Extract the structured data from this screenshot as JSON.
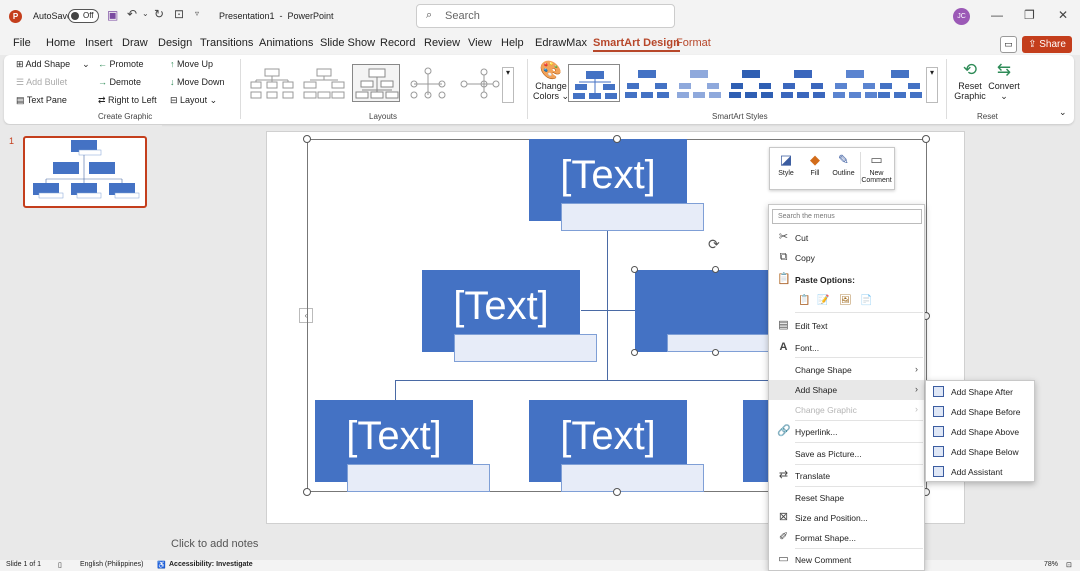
{
  "titlebar": {
    "autosave_label": "AutoSave",
    "autosave_state": "Off",
    "doc_title": "Presentation1  -  PowerPoint",
    "search_placeholder": "Search",
    "avatar_initials": "JC"
  },
  "tabs": [
    "File",
    "Home",
    "Insert",
    "Draw",
    "Design",
    "Transitions",
    "Animations",
    "Slide Show",
    "Record",
    "Review",
    "View",
    "Help",
    "EdrawMax",
    "SmartArt Design",
    "Format"
  ],
  "active_tab": "SmartArt Design",
  "share_label": "Share",
  "ribbon": {
    "create_graphic": {
      "add_shape": "Add Shape",
      "add_bullet": "Add Bullet",
      "text_pane": "Text Pane",
      "promote": "Promote",
      "demote": "Demote",
      "right_to_left": "Right to Left",
      "move_up": "Move Up",
      "move_down": "Move Down",
      "layout": "Layout",
      "group_label": "Create Graphic"
    },
    "layouts_label": "Layouts",
    "change_colors": [
      "Change",
      "Colors"
    ],
    "styles_label": "SmartArt Styles",
    "reset_graphic": [
      "Reset",
      "Graphic"
    ],
    "convert": "Convert",
    "reset_label": "Reset"
  },
  "thumbnail": {
    "number": "1"
  },
  "slide": {
    "nodes": [
      "[Text]",
      "[Text]",
      "[Text]",
      "[Text]",
      "[Text]"
    ]
  },
  "notes_placeholder": "Click to add notes",
  "status": {
    "slide_count": "Slide 1 of 1",
    "language": "English (Philippines)",
    "accessibility": "Accessibility: Investigate",
    "zoom": "78%"
  },
  "mini_toolbar": {
    "style": "Style",
    "fill": "Fill",
    "outline": "Outline",
    "new_comment": [
      "New",
      "Comment"
    ]
  },
  "context_menu": {
    "search_placeholder": "Search the menus",
    "cut": "Cut",
    "copy": "Copy",
    "paste_options": "Paste Options:",
    "edit_text": "Edit Text",
    "font": "Font...",
    "change_shape": "Change Shape",
    "add_shape": "Add Shape",
    "change_graphic": "Change Graphic",
    "hyperlink": "Hyperlink...",
    "save_as_picture": "Save as Picture...",
    "translate": "Translate",
    "reset_shape": "Reset Shape",
    "size_and_position": "Size and Position...",
    "format_shape": "Format Shape...",
    "new_comment": "New Comment"
  },
  "submenu": {
    "after": "Add Shape After",
    "before": "Add Shape Before",
    "above": "Add Shape Above",
    "below": "Add Shape Below",
    "assistant": "Add Assistant"
  },
  "colors": {
    "accent": "#b7472a",
    "shape_fill": "#4472c4",
    "share": "#c43e1c"
  }
}
